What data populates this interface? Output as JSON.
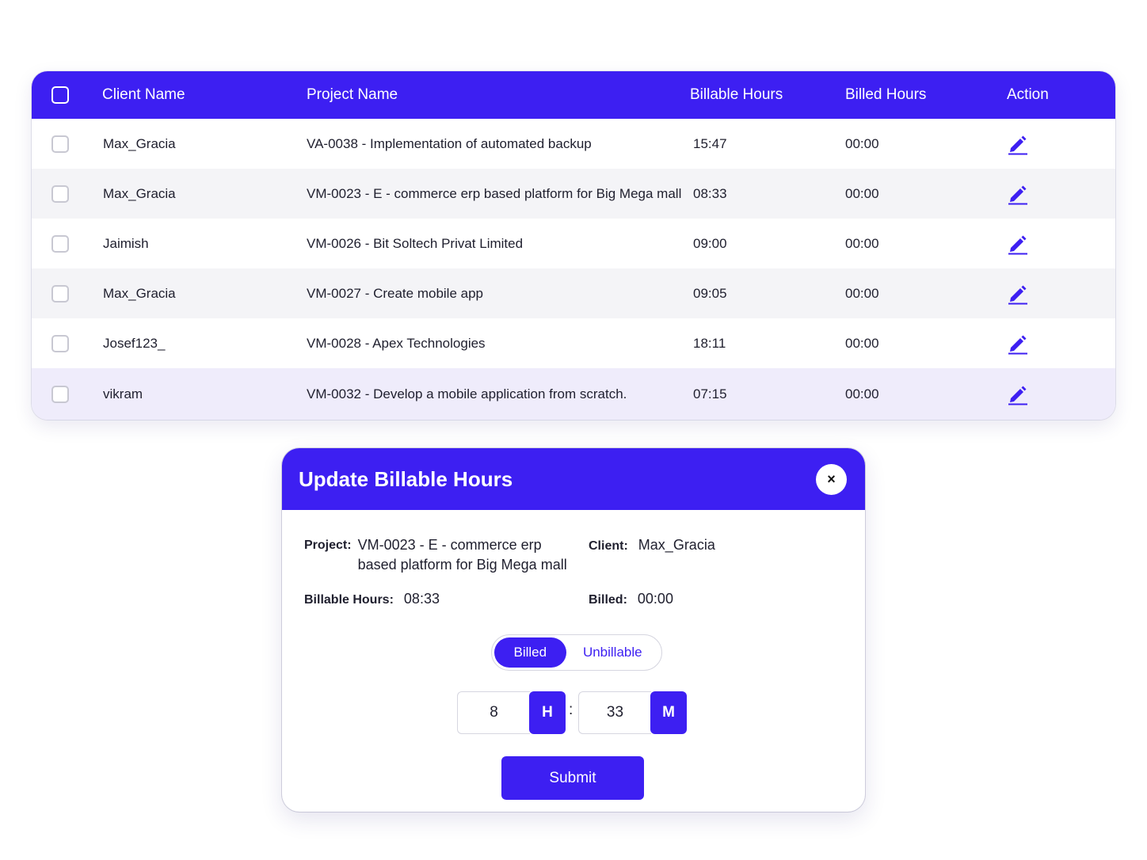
{
  "table": {
    "headers": {
      "client": "Client Name",
      "project": "Project Name",
      "billable": "Billable Hours",
      "billed": "Billed Hours",
      "action": "Action"
    },
    "rows": [
      {
        "client": "Max_Gracia",
        "project": "VA-0038 - Implementation of automated backup",
        "billable": "15:47",
        "billed": "00:00"
      },
      {
        "client": "Max_Gracia",
        "project": "VM-0023 - E - commerce erp based platform for Big Mega mall",
        "billable": "08:33",
        "billed": "00:00"
      },
      {
        "client": "Jaimish",
        "project": "VM-0026 - Bit Soltech Privat Limited",
        "billable": "09:00",
        "billed": "00:00"
      },
      {
        "client": "Max_Gracia",
        "project": "VM-0027 - Create mobile app",
        "billable": "09:05",
        "billed": "00:00"
      },
      {
        "client": "Josef123_",
        "project": "VM-0028 - Apex Technologies",
        "billable": "18:11",
        "billed": "00:00"
      },
      {
        "client": "vikram",
        "project": "VM-0032 - Develop a mobile application from scratch.",
        "billable": "07:15",
        "billed": "00:00"
      }
    ]
  },
  "modal": {
    "title": "Update Billable Hours",
    "close_label": "×",
    "project_label": "Project:",
    "project_value": "VM-0023 - E - commerce erp based platform for Big Mega mall",
    "client_label": "Client:",
    "client_value": "Max_Gracia",
    "billable_label": "Billable Hours:",
    "billable_value": "08:33",
    "billed_label": "Billed:",
    "billed_value": "00:00",
    "toggle": {
      "billed": "Billed",
      "unbillable": "Unbillable",
      "selected": "Billed"
    },
    "hours_value": "8",
    "hours_unit": "H",
    "separator": ":",
    "minutes_value": "33",
    "minutes_unit": "M",
    "submit_label": "Submit"
  },
  "colors": {
    "accent": "#3d1ff2",
    "row_alt": "#f4f4f7",
    "row_highlight": "#efecfb"
  },
  "icons": {
    "edit": "pencil-edit-icon",
    "close": "close-icon",
    "checkbox": "checkbox"
  }
}
